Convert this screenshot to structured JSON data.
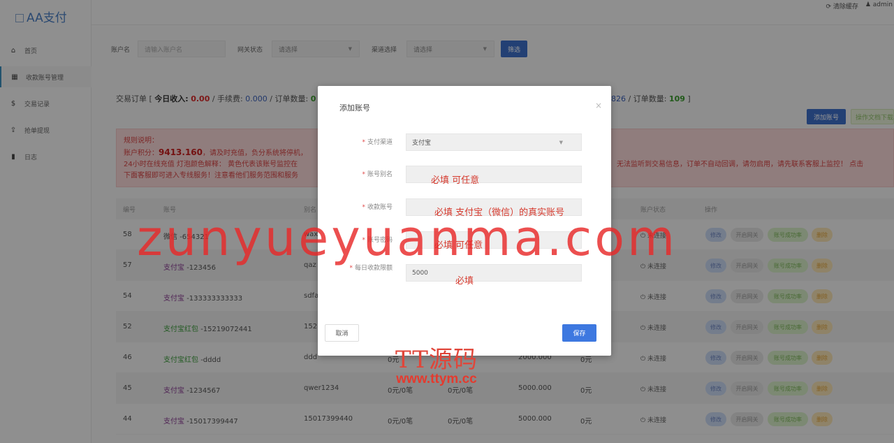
{
  "app": {
    "title": "AA支付"
  },
  "topbar": {
    "clear_cache": "清除缓存",
    "user": "admin"
  },
  "sidebar": {
    "items": [
      {
        "icon": "home-icon",
        "glyph": "⌂",
        "label": "首页"
      },
      {
        "icon": "table-icon",
        "glyph": "▦",
        "label": "收款账号管理"
      },
      {
        "icon": "dollar-icon",
        "glyph": "$",
        "label": "交易记录"
      },
      {
        "icon": "upload-icon",
        "glyph": "⇪",
        "label": "抢单提现"
      },
      {
        "icon": "book-icon",
        "glyph": "▮",
        "label": "日志"
      }
    ]
  },
  "filters": {
    "account_label": "账户名",
    "account_placeholder": "请输入账户名",
    "gateway_label": "网关状态",
    "gateway_value": "请选择",
    "channel_label": "渠道选择",
    "channel_value": "请选择",
    "filter_button": "筛选"
  },
  "stats": {
    "prefix": "交易订单 [",
    "income_label": "今日收入:",
    "income_value": "0.00",
    "fee_label": "/ 手续费:",
    "fee_value": "0.000",
    "count_label": "/ 订单数量:",
    "count_value": "0",
    "tail_sep": "] -",
    "right_value": "826",
    "right_count_label": "/ 订单数量:",
    "right_count_value": "109",
    "right_close": "]"
  },
  "actions": {
    "add_account": "添加账号",
    "docs": "操作文档下载"
  },
  "notice": {
    "line1": "规则说明：",
    "line2_prefix": "账户积分：",
    "line2_value": "9413.160",
    "line2_suffix": "，请及时充值，负分系统将停机，",
    "line3": "24小时在线充值 灯泡颜色解释：  黄色代表该账号监控在",
    "line3_right": "无法监听到交易信息，订单不自动回调，请勿启用，请先联系客服上监控！  点击",
    "line4": "下面客服即可进入专线服务！注意看他们服务范围和服务"
  },
  "table": {
    "headers": {
      "id": "编号",
      "account": "账号",
      "alias": "别名",
      "status": "账户状态",
      "ops": "操作"
    },
    "ops": {
      "edit": "修改",
      "gateway": "开启网关",
      "test": "账号成功率",
      "delete": "删除"
    },
    "rows": [
      {
        "id": "58",
        "channel": "微信",
        "num": "-654321",
        "alias": "wax",
        "c1": "",
        "c2": "",
        "c3": "",
        "c4": "",
        "status": "未连接",
        "type": "wechat"
      },
      {
        "id": "57",
        "channel": "支付宝",
        "num": "-123456",
        "alias": "qaz",
        "c1": "",
        "c2": "",
        "c3": "",
        "c4": "",
        "status": "未连接",
        "type": "alipay"
      },
      {
        "id": "54",
        "channel": "支付宝",
        "num": "-133333333333",
        "alias": "sdfa",
        "c1": "",
        "c2": "",
        "c3": "",
        "c4": "",
        "status": "未连接",
        "type": "alipay"
      },
      {
        "id": "52",
        "channel": "支付宝红包",
        "num": "-15219072441",
        "alias": "1521",
        "c1": "",
        "c2": "",
        "c3": "",
        "c4": "",
        "status": "未连接",
        "type": "hb"
      },
      {
        "id": "46",
        "channel": "支付宝红包",
        "num": "-dddd",
        "alias": "ddd",
        "c1": "0元",
        "c2": "",
        "c3": "2000.000",
        "c4": "0元",
        "status": "未连接",
        "type": "hb"
      },
      {
        "id": "45",
        "channel": "支付宝",
        "num": "-1234567",
        "alias": "qwer1234",
        "c1": "0元/0笔",
        "c2": "0元/0笔",
        "c3": "5000.000",
        "c4": "0元",
        "status": "未连接",
        "type": "alipay"
      },
      {
        "id": "44",
        "channel": "支付宝",
        "num": "-15017399447",
        "alias": "15017399440",
        "c1": "0元/0笔",
        "c2": "0元/0笔",
        "c3": "5000.000",
        "c4": "0元",
        "status": "未连接",
        "type": "alipay"
      }
    ]
  },
  "modal": {
    "title": "添加账号",
    "close": "×",
    "fields": {
      "channel_label": "支付渠道",
      "channel_value": "支付宝",
      "alias_label": "账号别名",
      "alias_value": "",
      "account_label": "收款账号",
      "account_value": "",
      "password_label": "账号密码",
      "password_value": "",
      "limit_label": "每日收款限额",
      "limit_value": "5000"
    },
    "hints": {
      "alias": "必填 可任意",
      "account": "必填 支付宝（微信）的真实账号",
      "password": "必填 可任意",
      "limit": "必填"
    },
    "cancel": "取消",
    "save": "保存"
  },
  "overlay_marks": {
    "watermark": "zunyueyuanma.com",
    "logo_cn": "TT源码",
    "logo_url": "www.ttym.cc"
  }
}
